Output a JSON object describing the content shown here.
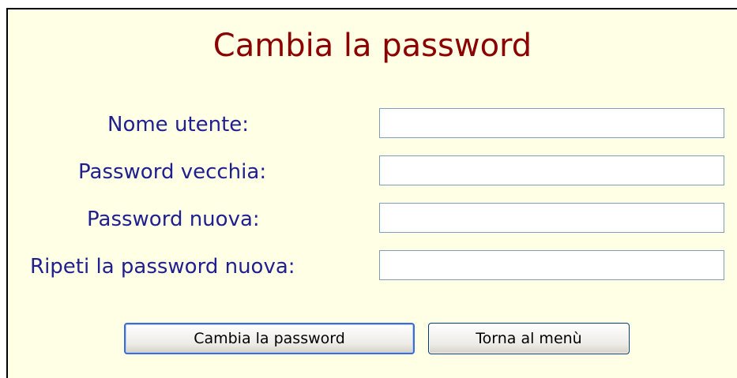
{
  "form": {
    "title": "Cambia la password",
    "fields": [
      {
        "label": "Nome utente:",
        "value": ""
      },
      {
        "label": "Password vecchia:",
        "value": ""
      },
      {
        "label": "Password nuova:",
        "value": ""
      },
      {
        "label": "Ripeti la password nuova:",
        "value": ""
      }
    ],
    "buttons": {
      "submit_label": "Cambia la password",
      "back_label": "Torna al menù"
    }
  },
  "colors": {
    "background": "#ffffe6",
    "title": "#8b0000",
    "label": "#1f1f8f",
    "input_border": "#7f9db9"
  }
}
